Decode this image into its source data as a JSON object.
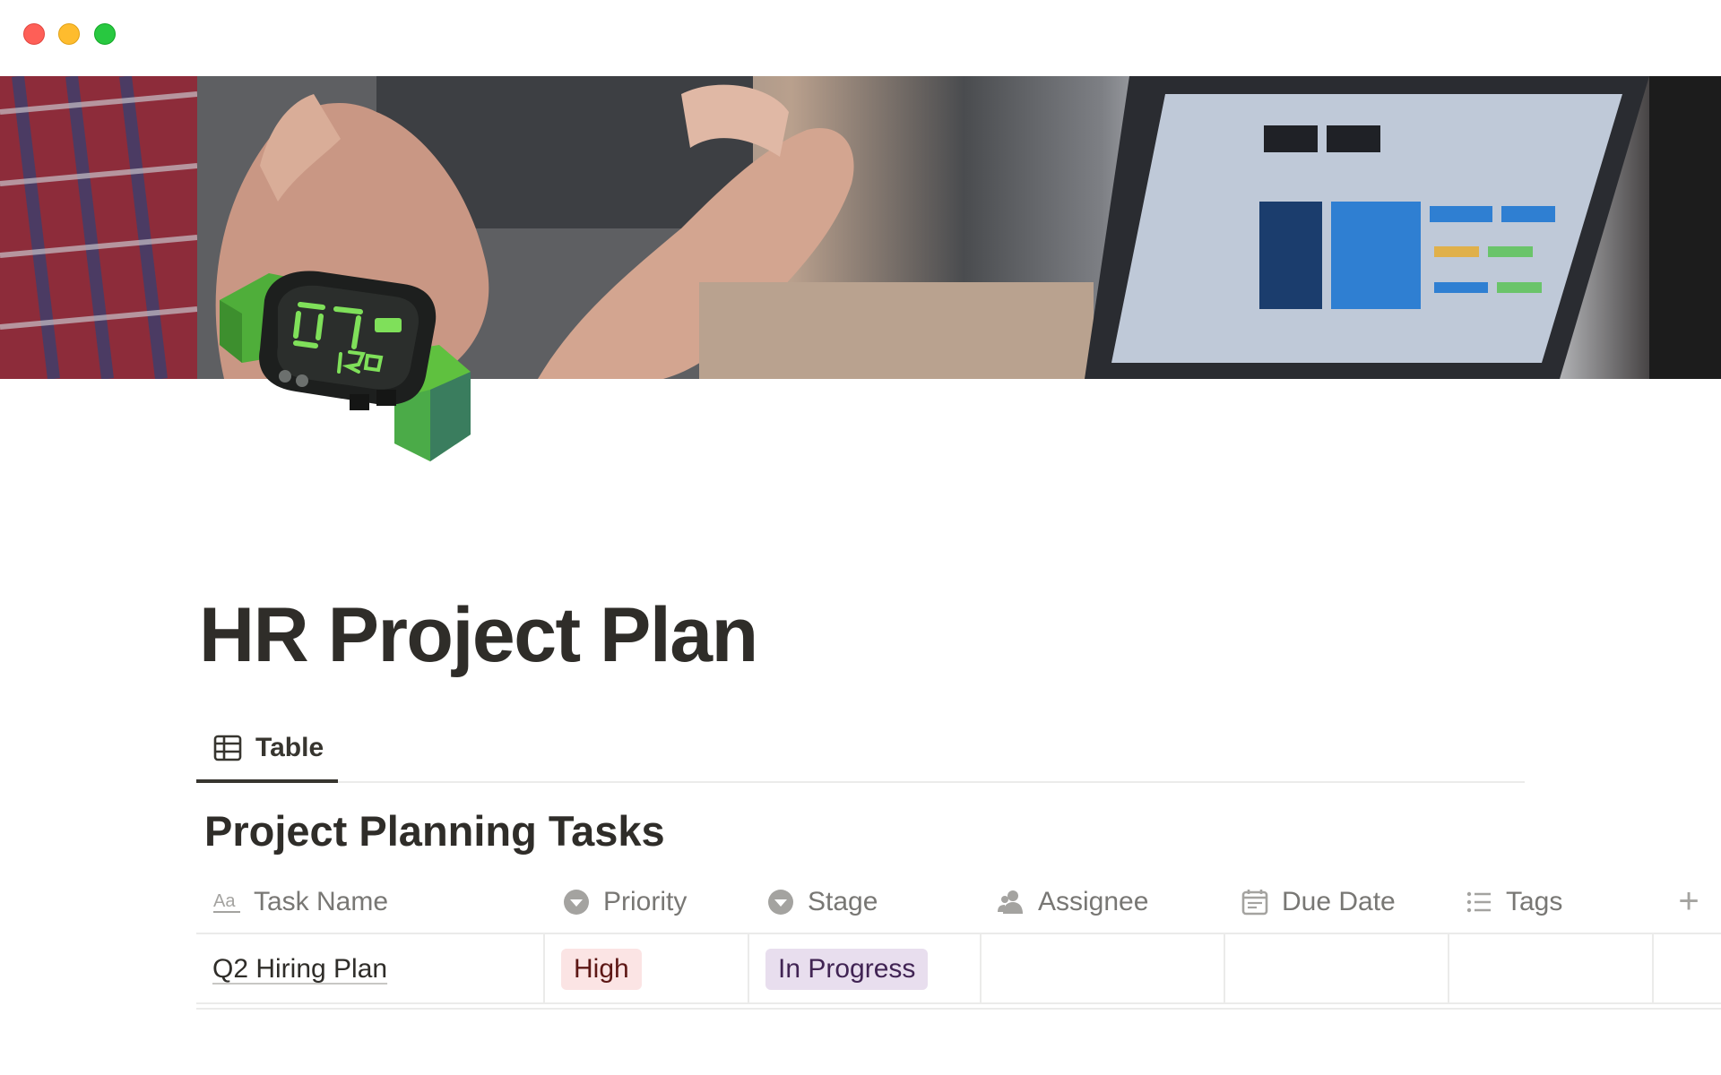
{
  "window": {
    "controls": [
      "close",
      "minimize",
      "maximize"
    ]
  },
  "cover": {
    "description_icon": "meeting-photo-cover"
  },
  "page": {
    "icon": "digital-watch-icon",
    "title": "HR Project Plan"
  },
  "views": [
    {
      "label": "Table",
      "icon": "table-icon",
      "active": true
    }
  ],
  "database": {
    "title": "Project Planning Tasks",
    "columns": [
      {
        "label": "Task Name",
        "icon": "text-property-icon"
      },
      {
        "label": "Priority",
        "icon": "select-property-icon"
      },
      {
        "label": "Stage",
        "icon": "select-property-icon"
      },
      {
        "label": "Assignee",
        "icon": "person-property-icon"
      },
      {
        "label": "Due Date",
        "icon": "calendar-property-icon"
      },
      {
        "label": "Tags",
        "icon": "list-property-icon"
      }
    ],
    "add_column_label": "+",
    "rows": [
      {
        "task_name": "Q2 Hiring Plan",
        "priority": "High",
        "stage": "In Progress",
        "assignee": "",
        "due_date": "",
        "tags": ""
      }
    ]
  },
  "colors": {
    "priority_high_bg": "#fbe4e4",
    "priority_high_text": "#5d1715",
    "stage_in_progress_bg": "#e8deee",
    "stage_in_progress_text": "#412454",
    "watch_green": "#5fc13f"
  }
}
